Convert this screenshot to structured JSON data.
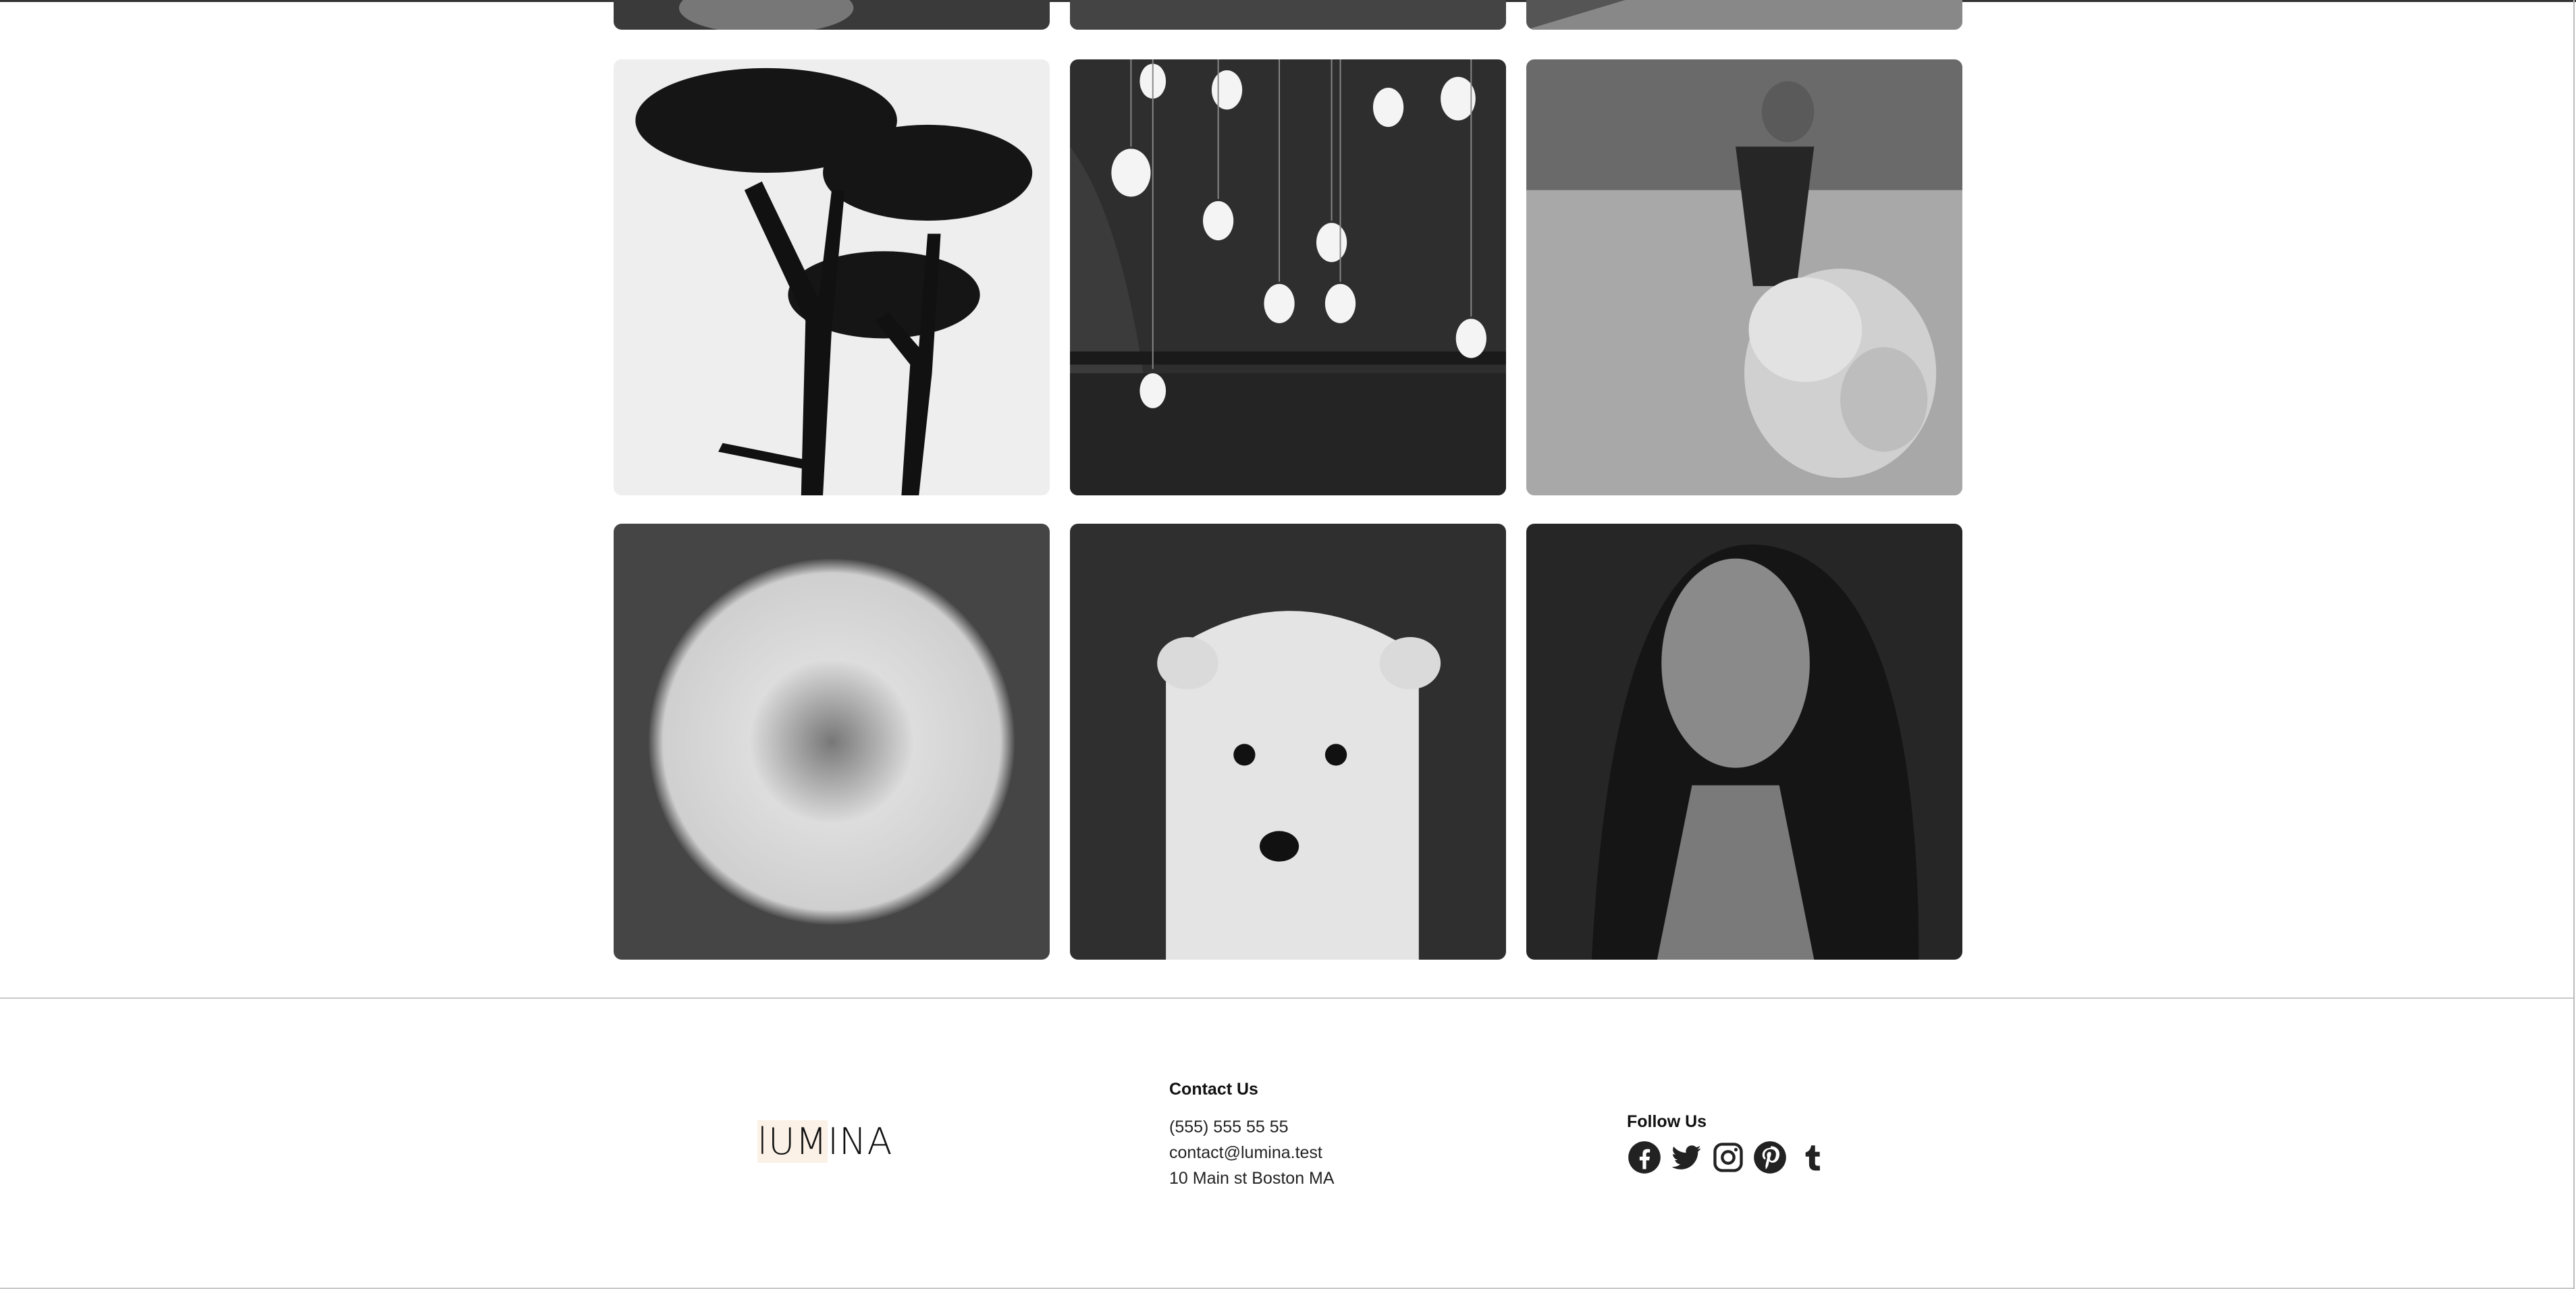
{
  "gallery": {
    "images": [
      {
        "name": "photo-partial-1"
      },
      {
        "name": "photo-partial-2"
      },
      {
        "name": "photo-partial-3"
      },
      {
        "name": "photo-trees-silhouette"
      },
      {
        "name": "photo-hanging-bulbs"
      },
      {
        "name": "photo-girl-teddy-lion"
      },
      {
        "name": "photo-dandelion"
      },
      {
        "name": "photo-polar-bear-cub"
      },
      {
        "name": "photo-woman-portrait"
      }
    ]
  },
  "footer": {
    "logo": {
      "text_part1": "lUM",
      "text_part2": "INA"
    },
    "contact": {
      "heading": "Contact Us",
      "phone": "(555) 555 55 55",
      "email": "contact@lumina.test",
      "address": "10 Main st Boston MA"
    },
    "follow": {
      "heading": "Follow Us",
      "icons": [
        "facebook-icon",
        "twitter-icon",
        "instagram-icon",
        "pinterest-icon",
        "tumblr-icon"
      ]
    }
  },
  "colors": {
    "icon": "#222222",
    "divider": "#c8c8c8",
    "logo_highlight": "#fbf1e6"
  }
}
